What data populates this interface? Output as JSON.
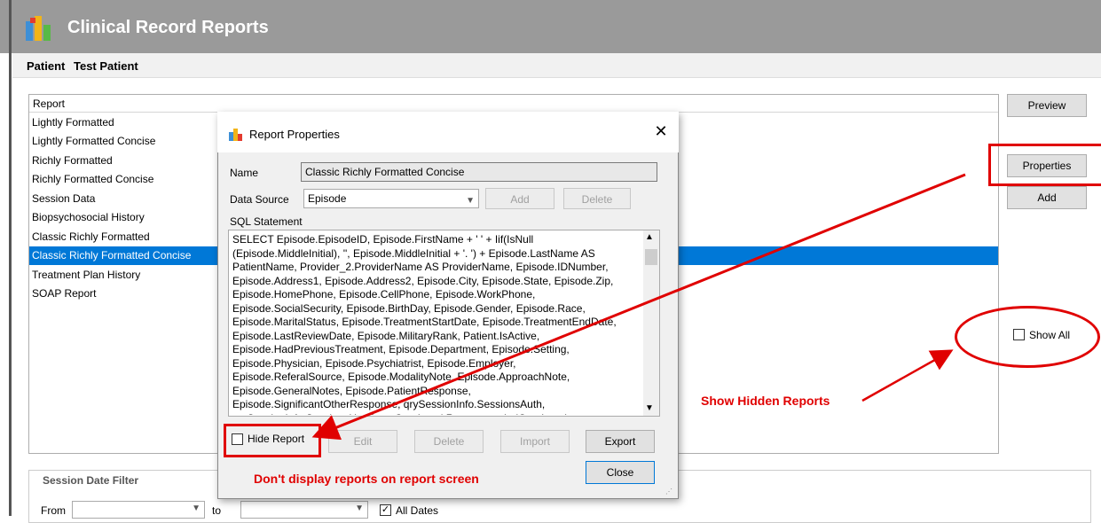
{
  "app": {
    "title": "Clinical Record Reports"
  },
  "patient": {
    "label": "Patient",
    "name": "Test Patient"
  },
  "report_list": {
    "header": "Report",
    "items": [
      "Lightly Formatted",
      "Lightly Formatted Concise",
      "Richly Formatted",
      "Richly Formatted Concise",
      "Session Data",
      "Biopsychosocial History",
      "Classic Richly Formatted",
      "Classic Richly Formatted Concise",
      "Treatment Plan History",
      "SOAP Report"
    ],
    "selected": "Classic Richly Formatted Concise"
  },
  "buttons": {
    "preview": "Preview",
    "properties": "Properties",
    "add": "Add"
  },
  "show_all": {
    "label": "Show All",
    "checked": false
  },
  "session_filter": {
    "title": "Session Date Filter",
    "from_label": "From",
    "to_label": "to",
    "all_dates_label": "All Dates",
    "all_dates_checked": true
  },
  "dialog": {
    "title": "Report Properties",
    "name_label": "Name",
    "name_value": "Classic Richly Formatted Concise",
    "data_source_label": "Data Source",
    "data_source_value": "Episode",
    "add": "Add",
    "delete": "Delete",
    "sql_label": "SQL Statement",
    "sql_text": "SELECT Episode.EpisodeID, Episode.FirstName + ' ' + Iif(IsNull\n(Episode.MiddleInitial), '', Episode.MiddleInitial + '. ') + Episode.LastName AS\nPatientName, Provider_2.ProviderName AS ProviderName, Episode.IDNumber,\nEpisode.Address1, Episode.Address2, Episode.City, Episode.State, Episode.Zip,\nEpisode.HomePhone, Episode.CellPhone, Episode.WorkPhone,\nEpisode.SocialSecurity, Episode.BirthDay, Episode.Gender, Episode.Race,\nEpisode.MaritalStatus, Episode.TreatmentStartDate, Episode.TreatmentEndDate,\nEpisode.LastReviewDate, Episode.MilitaryRank, Patient.IsActive,\nEpisode.HadPreviousTreatment, Episode.Department, Episode.Setting,\nEpisode.Physician, Episode.Psychiatrist, Episode.Employer,\nEpisode.ReferalSource, Episode.ModalityNote, Episode.ApproachNote,\nEpisode.GeneralNotes, Episode.PatientResponse,\nEpisode.SignificantOtherResponse, qrySessionInfo.SessionsAuth,\nqrySessionInfo.SessionsUsed, qryCareLevel.RecommendedCareLevel,",
    "hide_report_label": "Hide Report",
    "hide_report_checked": false,
    "edit": "Edit",
    "delete2": "Delete",
    "import": "Import",
    "export": "Export",
    "close": "Close"
  },
  "annotations": {
    "show_hidden": "Show Hidden Reports",
    "dont_display": "Don't display reports on report screen",
    "color": "#e00000"
  }
}
